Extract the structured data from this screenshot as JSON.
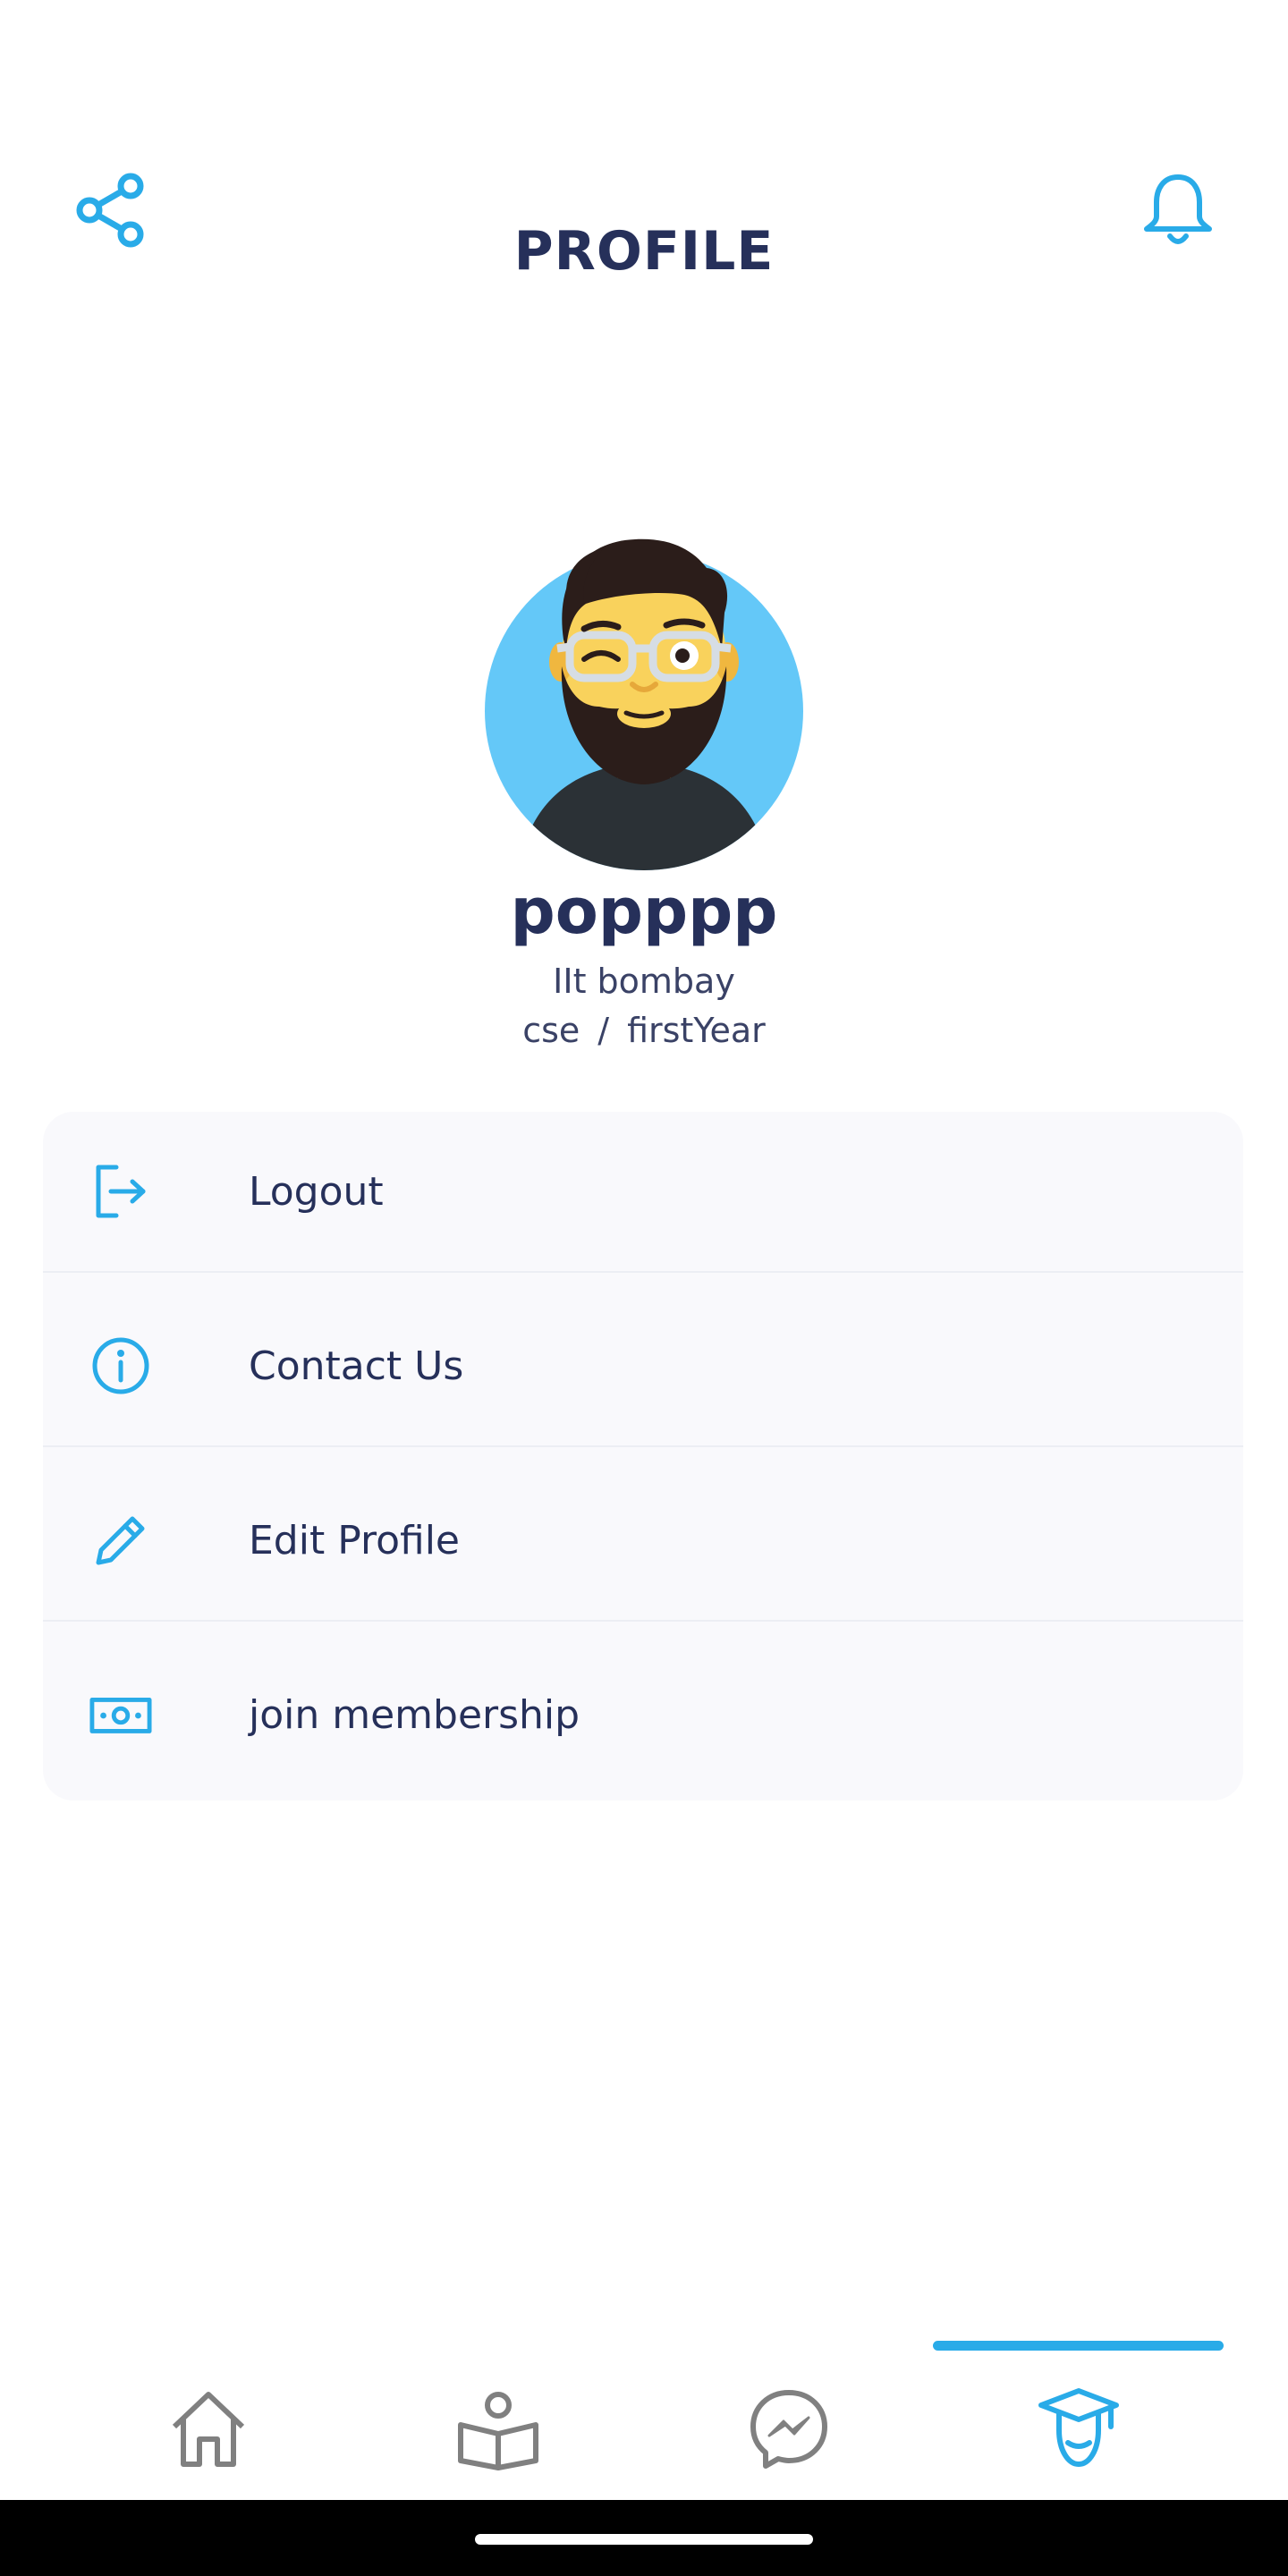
{
  "header": {
    "title": "PROFILE",
    "share_icon": "share-icon",
    "bell_icon": "bell-icon"
  },
  "profile": {
    "avatar": "bearded-man-avatar",
    "name": "popppp",
    "college": "IIt bombay",
    "branch": "cse",
    "separator": "/",
    "year": "firstYear"
  },
  "menu": {
    "items": [
      {
        "label": "Logout",
        "icon": "logout-icon"
      },
      {
        "label": "Contact Us",
        "icon": "info-icon"
      },
      {
        "label": "Edit Profile",
        "icon": "pencil-icon"
      },
      {
        "label": "join membership",
        "icon": "money-icon"
      }
    ]
  },
  "bottom_nav": {
    "tabs": [
      {
        "icon": "home-icon",
        "active": false
      },
      {
        "icon": "reading-icon",
        "active": false
      },
      {
        "icon": "messenger-icon",
        "active": false
      },
      {
        "icon": "graduate-icon",
        "active": true
      }
    ]
  },
  "colors": {
    "accent": "#29abe8",
    "text_dark": "#26305a",
    "inactive_icon": "#808080",
    "card_bg": "#f9f9fc"
  }
}
